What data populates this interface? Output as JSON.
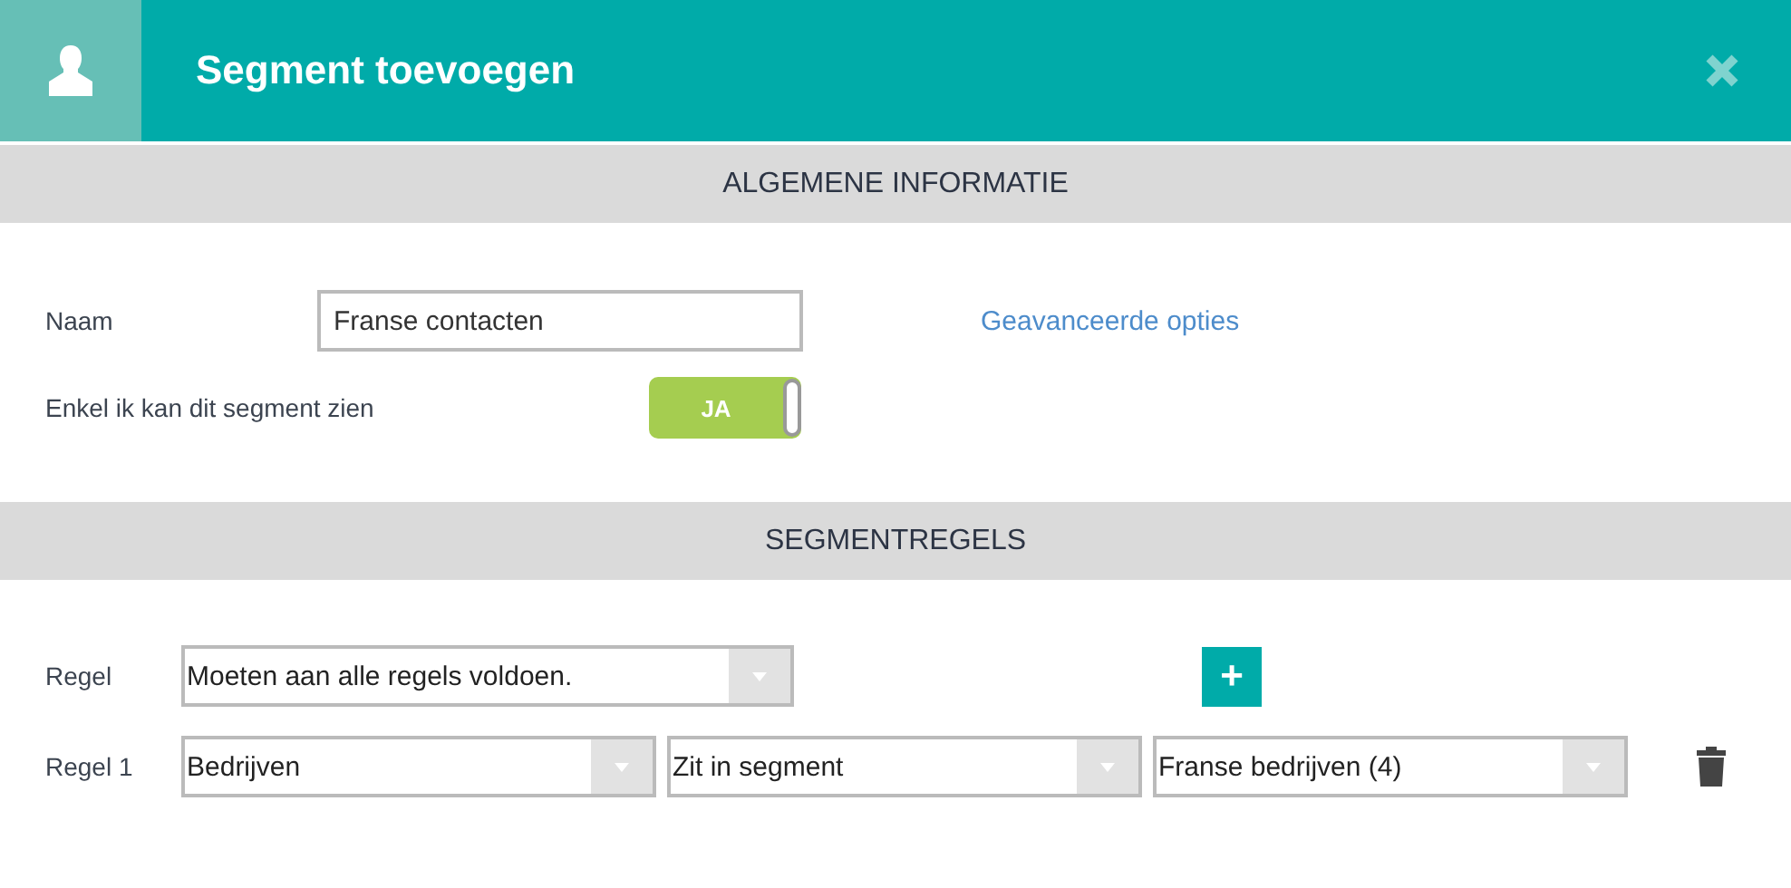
{
  "window": {
    "title": "Segment toevoegen"
  },
  "general": {
    "heading": "ALGEMENE INFORMATIE",
    "name_label": "Naam",
    "name_value": "Franse contacten",
    "advanced_link": "Geavanceerde opties",
    "private_label": "Enkel ik kan dit segment zien",
    "private_toggle": {
      "label": "JA",
      "on": true
    }
  },
  "rules": {
    "heading": "SEGMENTREGELS",
    "match_label": "Regel",
    "match_value": "Moeten aan alle regels voldoen.",
    "add_button": "+",
    "items": [
      {
        "label": "Regel 1",
        "values": [
          "Bedrijven",
          "Zit in segment",
          "Franse bedrijven (4)"
        ]
      }
    ]
  }
}
